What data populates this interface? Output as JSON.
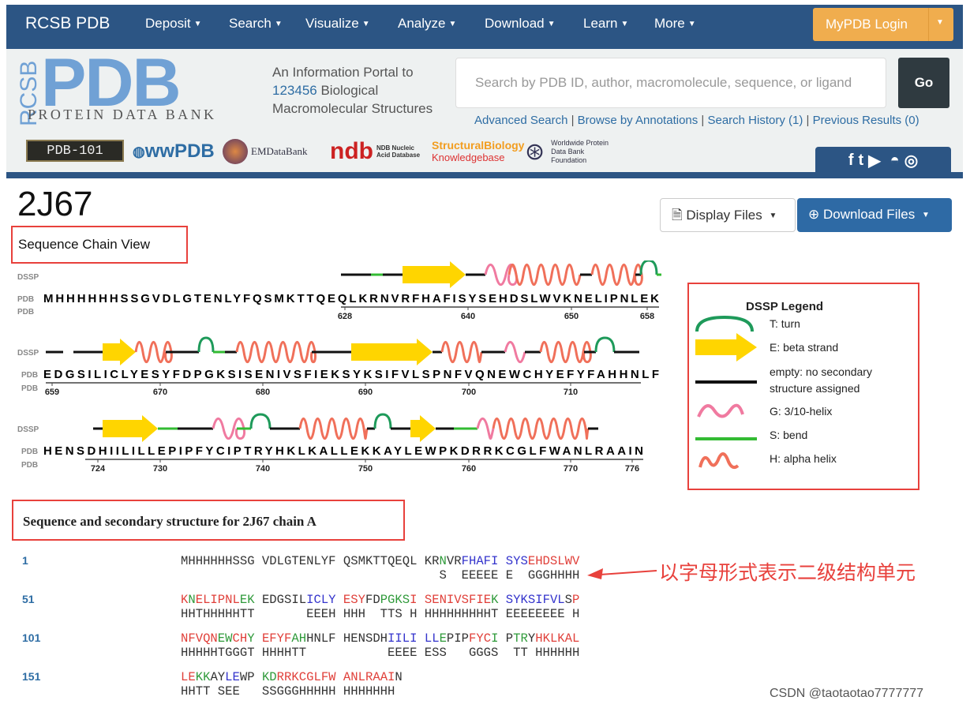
{
  "nav": {
    "brand": "RCSB PDB",
    "items": [
      {
        "label": "Deposit"
      },
      {
        "label": "Search"
      },
      {
        "label": "Visualize"
      },
      {
        "label": "Analyze"
      },
      {
        "label": "Download"
      },
      {
        "label": "Learn"
      },
      {
        "label": "More"
      }
    ],
    "login_label": "MyPDB Login"
  },
  "banner": {
    "logo_side": "RCSB",
    "logo_main": "PDB",
    "logo_sub": "PROTEIN DATA BANK",
    "tagline_1": "An Information Portal to",
    "count": "123456",
    "tagline_2": " Biological",
    "tagline_3": "Macromolecular Structures",
    "search_placeholder": "Search by PDB ID, author, macromolecule, sequence, or ligand",
    "go_label": "Go",
    "links": [
      "Advanced Search",
      "Browse by Annotations",
      "Search History (1)",
      "Previous Results (0)"
    ],
    "partners": [
      "PDB-101",
      "wwPDB",
      "EMDataBank",
      "NDB Nucleic Acid Database",
      "StructuralBiology",
      "Knowledgebase",
      "Worldwide Protein Data Bank Foundation"
    ],
    "social_icons": [
      "facebook-icon",
      "twitter-icon",
      "youtube-icon",
      "apple-icon",
      "android-icon",
      "github-icon"
    ]
  },
  "structure": {
    "id": "2J67",
    "display_files": "Display Files",
    "download_files": "Download Files"
  },
  "chain_view": {
    "title": "Sequence Chain View",
    "track_label": "DSSP",
    "seq_label": "PDB",
    "rows": [
      {
        "sequence": "MHHHHHHSSGVDLGTENLYFQSMKTTQEQLKRNVRFHAFISYSEHDSLWVKNELIPNLEK",
        "ticks": [
          "628",
          "640",
          "650",
          "658"
        ]
      },
      {
        "sequence": "EDGSILICLYESYFDPGKSISENIVSFIEKSYKSIFVLSPNFVQNEWCHYEFYFAHHNLF",
        "ticks": [
          "659",
          "670",
          "680",
          "690",
          "700",
          "710"
        ]
      },
      {
        "sequence": "HENSDHIILILLEPIPFYCIPTRYHKLKALLEKKAYLEWPKDRRKCGLFWANLRAAIN",
        "ticks": [
          "724",
          "730",
          "740",
          "750",
          "760",
          "770",
          "776"
        ]
      }
    ]
  },
  "legend": {
    "title": "DSSP Legend",
    "items": [
      {
        "label": "T: turn"
      },
      {
        "label": "E: beta strand"
      },
      {
        "label": "empty: no secondary structure assigned"
      },
      {
        "label": "G: 3/10-helix"
      },
      {
        "label": "S: bend"
      },
      {
        "label": "H: alpha helix"
      }
    ],
    "colors": {
      "turn": "#1e9a5a",
      "strand": "#ffd500",
      "none": "#111111",
      "g_helix": "#f07aa0",
      "bend": "#33bb33",
      "alpha": "#f0705a"
    }
  },
  "ss_section": {
    "title": "Sequence and secondary structure for 2J67 chain A",
    "colors": {
      "red": "#e0403a",
      "green": "#2f9a3a",
      "blue": "#3434cc",
      "black": "#333333"
    },
    "blocks": [
      {
        "start": "1",
        "segments": [
          [
            "MHHHHHHSSG VDLGTENLYF QSMKTTQEQL KR",
            "black"
          ],
          [
            "N",
            "green"
          ],
          [
            "VR",
            "black"
          ],
          [
            "FHAFI",
            "blue"
          ],
          [
            " ",
            "black"
          ],
          [
            "SYS",
            "blue"
          ],
          [
            "EHDSLWV",
            "red"
          ]
        ],
        "ss": "                                   S  EEEEE E  GGGHHHH"
      },
      {
        "start": "51",
        "segments": [
          [
            "K",
            "red"
          ],
          [
            "N",
            "green"
          ],
          [
            "ELIPNL",
            "red"
          ],
          [
            "EK",
            "green"
          ],
          [
            " EDGSIL",
            "black"
          ],
          [
            "ICLY",
            "blue"
          ],
          [
            " ",
            "black"
          ],
          [
            "ESY",
            "red"
          ],
          [
            "FD",
            "black"
          ],
          [
            "PGKS",
            "green"
          ],
          [
            "I",
            "red"
          ],
          [
            " SENIVSFIE",
            "red"
          ],
          [
            "K",
            "green"
          ],
          [
            " ",
            "black"
          ],
          [
            "SYKSIFVL",
            "blue"
          ],
          [
            "S",
            "black"
          ],
          [
            "P",
            "red"
          ]
        ],
        "ss": "HHTHHHHHTT       EEEH HHH  TTS H HHHHHHHHHT EEEEEEEE H"
      },
      {
        "start": "101",
        "segments": [
          [
            "NFVQN",
            "red"
          ],
          [
            "EW",
            "green"
          ],
          [
            "CH",
            "red"
          ],
          [
            "Y",
            "green"
          ],
          [
            " EFYF",
            "red"
          ],
          [
            "AH",
            "green"
          ],
          [
            "HNLF HENSDH",
            "black"
          ],
          [
            "IILI",
            "blue"
          ],
          [
            " ",
            "black"
          ],
          [
            "LL",
            "blue"
          ],
          [
            "E",
            "green"
          ],
          [
            "PIP",
            "black"
          ],
          [
            "FYC",
            "red"
          ],
          [
            "I",
            "green"
          ],
          [
            " P",
            "black"
          ],
          [
            "TR",
            "green"
          ],
          [
            "Y",
            "black"
          ],
          [
            "HKLKAL",
            "red"
          ]
        ],
        "ss": "HHHHHTGGGT HHHHTT           EEEE ESS   GGGS  TT HHHHHH"
      },
      {
        "start": "151",
        "segments": [
          [
            "LE",
            "red"
          ],
          [
            "KK",
            "green"
          ],
          [
            "AY",
            "black"
          ],
          [
            "LE",
            "blue"
          ],
          [
            "WP",
            "black"
          ],
          [
            " KD",
            "green"
          ],
          [
            "RRKCGLFW",
            "red"
          ],
          [
            " ANLRAAI",
            "red"
          ],
          [
            "N",
            "black"
          ]
        ],
        "ss": "HHTT SEE   SSGGGHHHHH HHHHHHH"
      }
    ]
  },
  "annotation": "以字母形式表示二级结构单元",
  "watermark": "CSDN @taotaotao7777777"
}
